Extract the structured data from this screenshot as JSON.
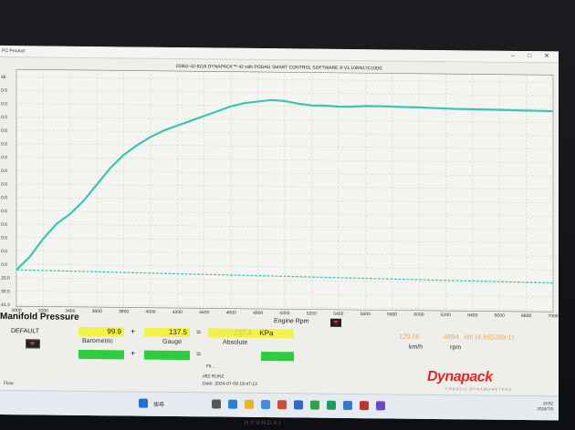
{
  "window": {
    "app_label": "PC Product",
    "controls": "– □ ✕"
  },
  "chart_title": "01862-42-8116 DYNAPACK™ 42 with PODAG SMART CONTROL SOFTWARE ® V1.10RN17C10DC",
  "chart_data": {
    "type": "line",
    "xlabel": "Engine Rpm",
    "x_ticks": [
      3000,
      3200,
      3400,
      3600,
      3800,
      4000,
      4200,
      4400,
      4600,
      4800,
      5000,
      5200,
      5400,
      5600,
      5800,
      6000,
      6200,
      6400,
      6600,
      6800,
      7000
    ],
    "x_tick_labels": [
      "3000",
      "3200",
      "3400",
      "3600",
      "3800",
      "4000",
      "4200",
      "4400",
      "4600",
      "4800",
      "5000",
      "5200",
      "5400",
      "5600",
      "5800",
      "6000",
      "6200",
      "6400",
      "6600",
      "6800",
      "7000"
    ],
    "xlim": [
      3000,
      7000
    ],
    "y_tick_labels": [
      "46",
      "0.0",
      "0.0",
      "0.0",
      "0.0",
      "0.0",
      "0.0",
      "0.0",
      "0.0",
      "0.0",
      "0.0",
      "0.0",
      "0.0",
      "0.0",
      "0.0",
      "20.0",
      "30.0",
      "41.3"
    ],
    "grid": true,
    "series": [
      {
        "color": "#3cc4b4",
        "x": [
          3000,
          3100,
          3200,
          3300,
          3400,
          3500,
          3600,
          3700,
          3800,
          3900,
          4000,
          4100,
          4200,
          4300,
          4400,
          4500,
          4600,
          4700,
          4800,
          4900,
          5000,
          5100,
          5200,
          5300,
          5400,
          5500,
          5600,
          5700,
          5800,
          5900,
          6000,
          6100,
          6200,
          6300,
          6400,
          6500,
          6600,
          6700,
          6800,
          6900,
          7000
        ],
        "y": [
          0.0,
          0.08,
          0.19,
          0.28,
          0.34,
          0.42,
          0.52,
          0.62,
          0.7,
          0.76,
          0.81,
          0.85,
          0.88,
          0.91,
          0.94,
          0.97,
          1.0,
          1.02,
          1.03,
          1.04,
          1.035,
          1.02,
          1.01,
          1.01,
          1.005,
          1.005,
          1.01,
          1.01,
          1.008,
          1.006,
          1.005,
          1.002,
          1.0,
          0.998,
          0.997,
          0.996,
          0.995,
          0.994,
          0.993,
          0.992,
          0.99
        ]
      },
      {
        "color": "#3cc4b4",
        "x": [
          3000,
          7000
        ],
        "y": [
          0.0,
          -0.045
        ]
      }
    ]
  },
  "section_title": "Manifold Pressure",
  "default_label": "DEFAULT",
  "readouts": {
    "barometric_value": "99.9",
    "barometric_label": "Barometric",
    "gauge_value": "137.5",
    "gauge_label": "Gauge",
    "absolute_value": "237.4",
    "absolute_unit": "KPa",
    "absolute_label": "Absolute",
    "plus": "+",
    "equals": "=",
    "speed_value": "120.06",
    "speed_unit": "km/h",
    "rpm_value": "4894",
    "rpm_extra": "4th (4.665399:1)",
    "rpm_unit": "rpm"
  },
  "run_info": {
    "id": "#82 RUN2",
    "date": "Date: 2024-07-09 18:47:13",
    "flt": "Flt..."
  },
  "logo": {
    "text": "Dynapack",
    "sub": "CHASSIS DYNAMOMETERS"
  },
  "taskbar": {
    "search": "搜尋",
    "clock_time": "18:52",
    "clock_date": "2024/7/9",
    "task_item": "Flow"
  },
  "brand": "HYUNDAI"
}
